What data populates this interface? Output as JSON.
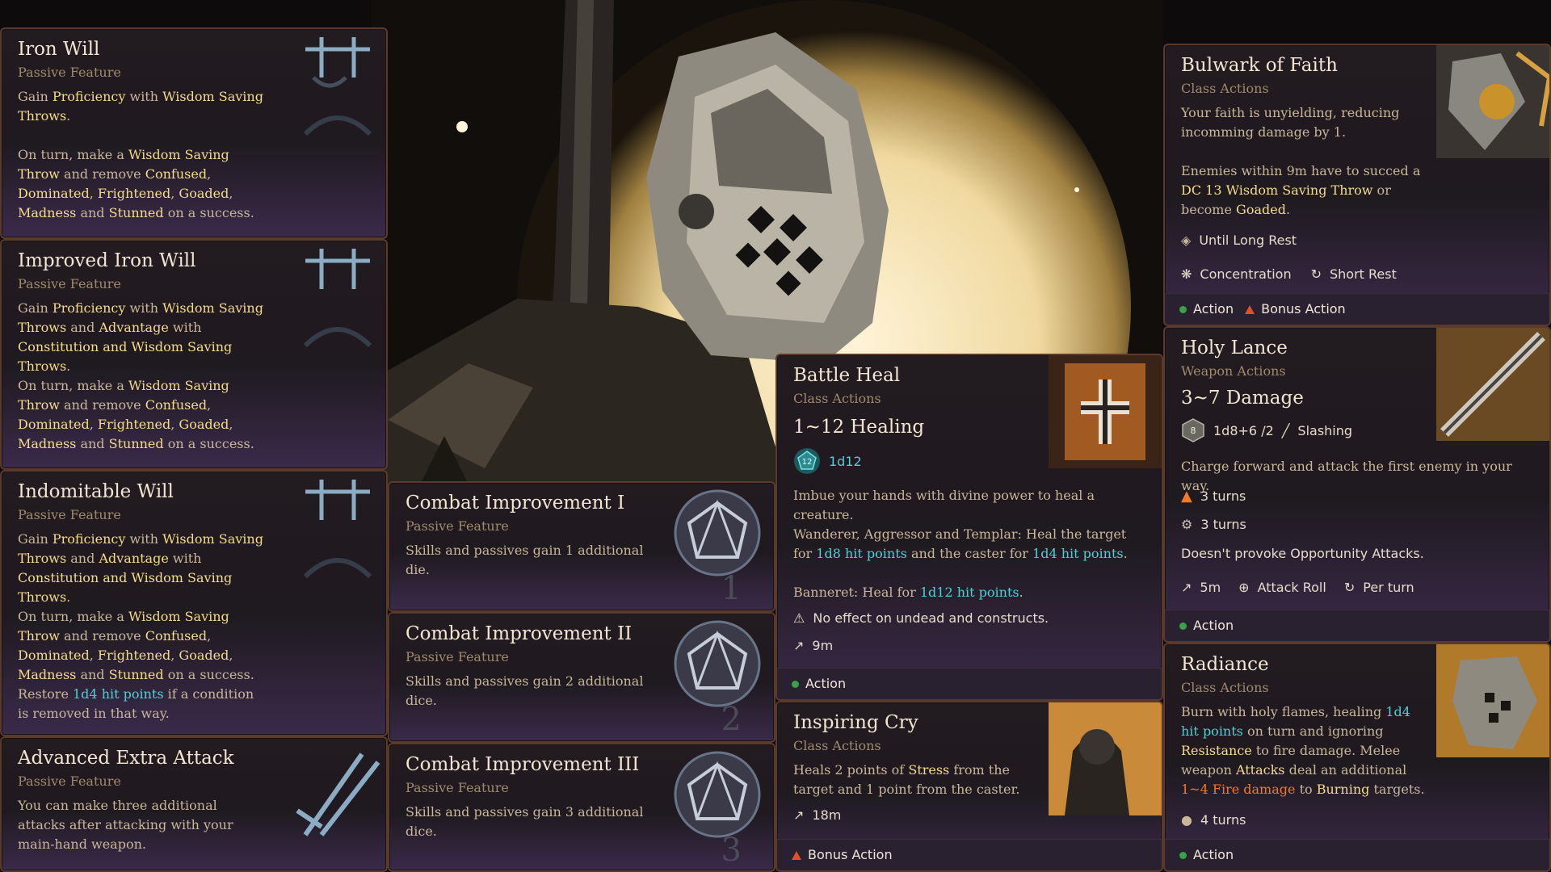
{
  "cards": {
    "iron_will": {
      "title": "Iron Will",
      "sub": "Passive Feature",
      "p1": [
        "Gain ",
        "Proficiency",
        " with ",
        "Wisdom Saving Throws",
        "."
      ],
      "p2": [
        "On turn, make a ",
        "Wisdom Saving Throw",
        " and remove ",
        "Confused",
        ", ",
        "Dominated",
        ", ",
        "Frightened",
        ", ",
        "Goaded",
        ", ",
        "Madness",
        " and ",
        "Stunned",
        " on a success."
      ]
    },
    "improved_iron_will": {
      "title": "Improved Iron Will",
      "sub": "Passive Feature",
      "p1": [
        "Gain ",
        "Proficiency",
        " with ",
        "Wisdom Saving Throws",
        " and ",
        "Advantage",
        " with ",
        "Constitution and Wisdom Saving Throws",
        "."
      ],
      "p2": [
        "On turn, make a ",
        "Wisdom Saving Throw",
        " and remove ",
        "Confused",
        ", ",
        "Dominated",
        ", ",
        "Frightened",
        ", ",
        "Goaded",
        ", ",
        "Madness",
        " and ",
        "Stunned",
        " on a success."
      ]
    },
    "indomitable_will": {
      "title": "Indomitable Will",
      "sub": "Passive Feature",
      "p1": [
        "Gain ",
        "Proficiency",
        " with ",
        "Wisdom Saving Throws",
        " and ",
        "Advantage",
        " with ",
        "Constitution and Wisdom Saving Throws",
        "."
      ],
      "p2": [
        "On turn, make a ",
        "Wisdom Saving Throw",
        " and remove ",
        "Confused",
        ", ",
        "Dominated",
        ", ",
        "Frightened",
        ", ",
        "Goaded",
        ", ",
        "Madness",
        " and ",
        "Stunned",
        " on a success. Restore ",
        "1d4 hit points",
        " if a condition is removed in that way."
      ]
    },
    "advanced_extra_attack": {
      "title": "Advanced Extra Attack",
      "sub": "Passive Feature",
      "body": "You can make three additional attacks after attacking with your main-hand weapon."
    },
    "combat_1": {
      "title": "Combat Improvement I",
      "sub": "Passive Feature",
      "body": "Skills and passives gain 1 additional die.",
      "num": "1"
    },
    "combat_2": {
      "title": "Combat Improvement II",
      "sub": "Passive Feature",
      "body": "Skills and passives gain 2 additional dice.",
      "num": "2"
    },
    "combat_3": {
      "title": "Combat Improvement III",
      "sub": "Passive Feature",
      "body": "Skills and passives gain 3 additional dice.",
      "num": "3"
    },
    "battle_heal": {
      "title": "Battle Heal",
      "sub": "Class Actions",
      "big": "1~12 Healing",
      "dice": "1d12",
      "dice_badge": "12",
      "desc": "Imbue your hands with divine power to heal a creature.",
      "p2": [
        "Wanderer, Aggressor and Templar: Heal the target for ",
        "1d8 hit points",
        " and the caster for ",
        "1d4 hit points",
        "."
      ],
      "p3": [
        "Banneret: Heal for ",
        "1d12 hit points",
        "."
      ],
      "warning": "No effect on undead and constructs.",
      "range": "9m",
      "action": "Action"
    },
    "inspiring_cry": {
      "title": "Inspiring Cry",
      "sub": "Class Actions",
      "p1": [
        "Heals 2 points of ",
        "Stress",
        " from the target and 1 point from the caster."
      ],
      "range": "18m",
      "action": "Bonus Action"
    },
    "bulwark": {
      "title": "Bulwark of Faith",
      "sub": "Class Actions",
      "p1": "Your faith is unyielding, reducing incomming damage by 1.",
      "p2": [
        "Enemies within 9m have to succed a ",
        "DC 13 Wisdom Saving Throw",
        " or become ",
        "Goaded",
        "."
      ],
      "duration": "Until Long Rest",
      "conc": "Concentration",
      "rest": "Short Rest",
      "action": "Action",
      "bonus": "Bonus Action"
    },
    "holy_lance": {
      "title": "Holy Lance",
      "sub": "Weapon Actions",
      "big": "3~7 Damage",
      "dmg": "1d8+6 /2",
      "dmg_badge": "8",
      "dmg_type": "Slashing",
      "desc": "Charge forward and attack the first enemy in your way.",
      "t1": "3 turns",
      "t2": "3 turns",
      "note": "Doesn't provoke Opportunity Attacks.",
      "range": "5m",
      "roll": "Attack Roll",
      "per": "Per turn",
      "action": "Action"
    },
    "radiance": {
      "title": "Radiance",
      "sub": "Class Actions",
      "p1": [
        "Burn with holy flames, healing ",
        "1d4 hit points",
        " on turn and ignoring ",
        "Resistance",
        " to fire damage. Melee weapon ",
        "Attacks",
        " deal an additional ",
        "1~4 Fire damage",
        " to ",
        "Burning",
        " targets."
      ],
      "turns": "4 turns",
      "action": "Action"
    }
  },
  "colors": {
    "highlight": "#f5dc8a",
    "cyan": "#4fd0d6",
    "orange": "#f07a2a",
    "action_green": "#3aa04a",
    "bonus_red": "#e0502a"
  }
}
